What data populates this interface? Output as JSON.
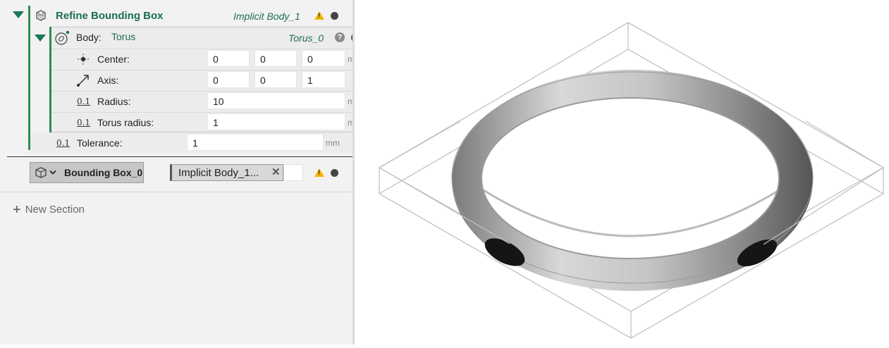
{
  "refine": {
    "title": "Refine Bounding Box",
    "reference": "Implicit Body_1"
  },
  "body": {
    "label": "Body:",
    "type": "Torus",
    "instance": "Torus_0",
    "help_glyph": "?",
    "center": {
      "label": "Center:",
      "x": "0",
      "y": "0",
      "z": "0",
      "unit": "mm"
    },
    "axis": {
      "label": "Axis:",
      "x": "0",
      "y": "0",
      "z": "1"
    },
    "radius": {
      "label": "Radius:",
      "value": "10",
      "unit": "mm"
    },
    "torus_radius": {
      "label": "Torus radius:",
      "value": "1",
      "unit": "mm"
    }
  },
  "tolerance": {
    "label": "Tolerance:",
    "value": "1",
    "unit": "mm"
  },
  "bounding_box": {
    "label": "Bounding Box_0",
    "reference": "Implicit Body_1...",
    "remove_glyph": "✕"
  },
  "new_section_label": "New Section",
  "number_icon_text": "0.1",
  "warning_glyph": "!",
  "colors": {
    "accent_green": "#1d6f4e",
    "warning": "#f0b400",
    "panel_bg": "#f2f2f2"
  },
  "icons": {
    "refine": "mesh-cube-icon",
    "body": "torus-icon",
    "center": "point-crosshair-icon",
    "axis": "diagonal-arrow-icon",
    "bounding_box": "box-icon",
    "warning": "warning-triangle-icon",
    "status": "status-dot-icon",
    "add": "plus-icon"
  }
}
